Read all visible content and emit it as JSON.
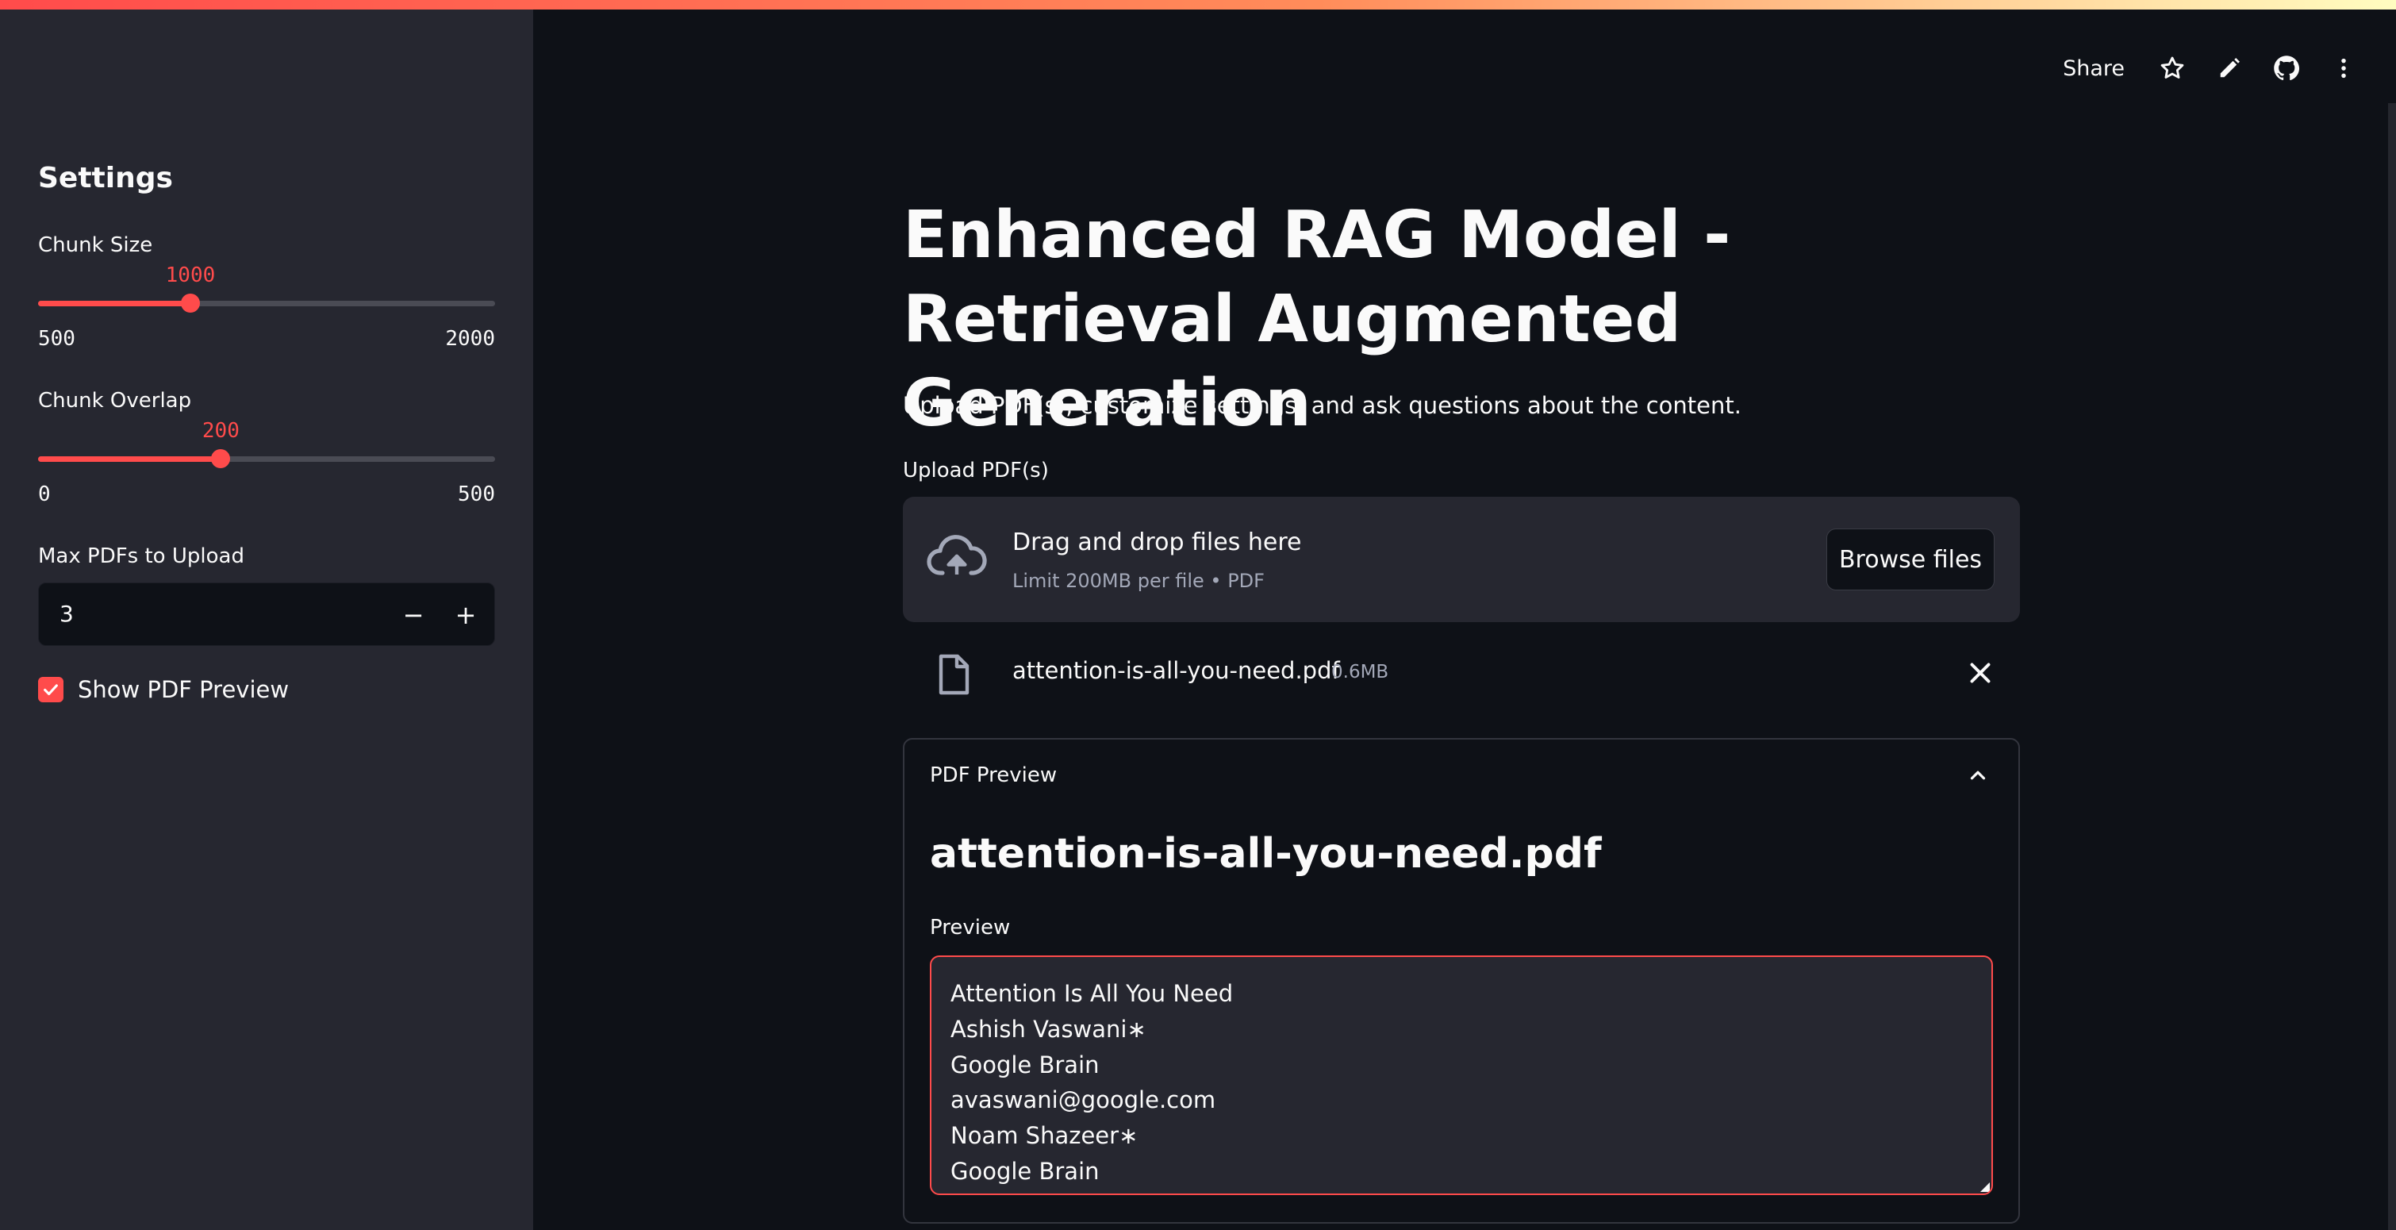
{
  "sidebar": {
    "title": "Settings",
    "chunk_size": {
      "label": "Chunk Size",
      "value": "1000",
      "min": "500",
      "max": "2000",
      "fraction": 0.3333
    },
    "chunk_overlap": {
      "label": "Chunk Overlap",
      "value": "200",
      "min": "0",
      "max": "500",
      "fraction": 0.4
    },
    "max_pdfs": {
      "label": "Max PDFs to Upload",
      "value": "3",
      "minus": "−",
      "plus": "+"
    },
    "show_preview": {
      "label": "Show PDF Preview",
      "checked": true
    }
  },
  "header": {
    "share_label": "Share",
    "icons": [
      "star-icon",
      "pencil-icon",
      "github-icon",
      "more-vertical-icon"
    ]
  },
  "main": {
    "title": "Enhanced RAG Model - Retrieval Augmented Generation",
    "subtitle": "Upload PDF(s), customize settings, and ask questions about the content.",
    "upload": {
      "label": "Upload PDF(s)",
      "drop_text": "Drag and drop files here",
      "limit_text": "Limit 200MB per file • PDF",
      "browse_label": "Browse files"
    },
    "file": {
      "name": "attention-is-all-you-need.pdf",
      "size": "0.6MB"
    },
    "expander": {
      "title": "PDF Preview",
      "heading": "attention-is-all-you-need.pdf",
      "preview_label": "Preview",
      "preview_lines": [
        "Attention Is All You Need",
        "Ashish Vaswani∗",
        "Google Brain",
        "avaswani@google.com",
        "Noam Shazeer∗",
        "Google Brain"
      ]
    }
  },
  "colors": {
    "accent": "#ff4b4b",
    "background": "#0e1117",
    "sidebar": "#262730"
  }
}
